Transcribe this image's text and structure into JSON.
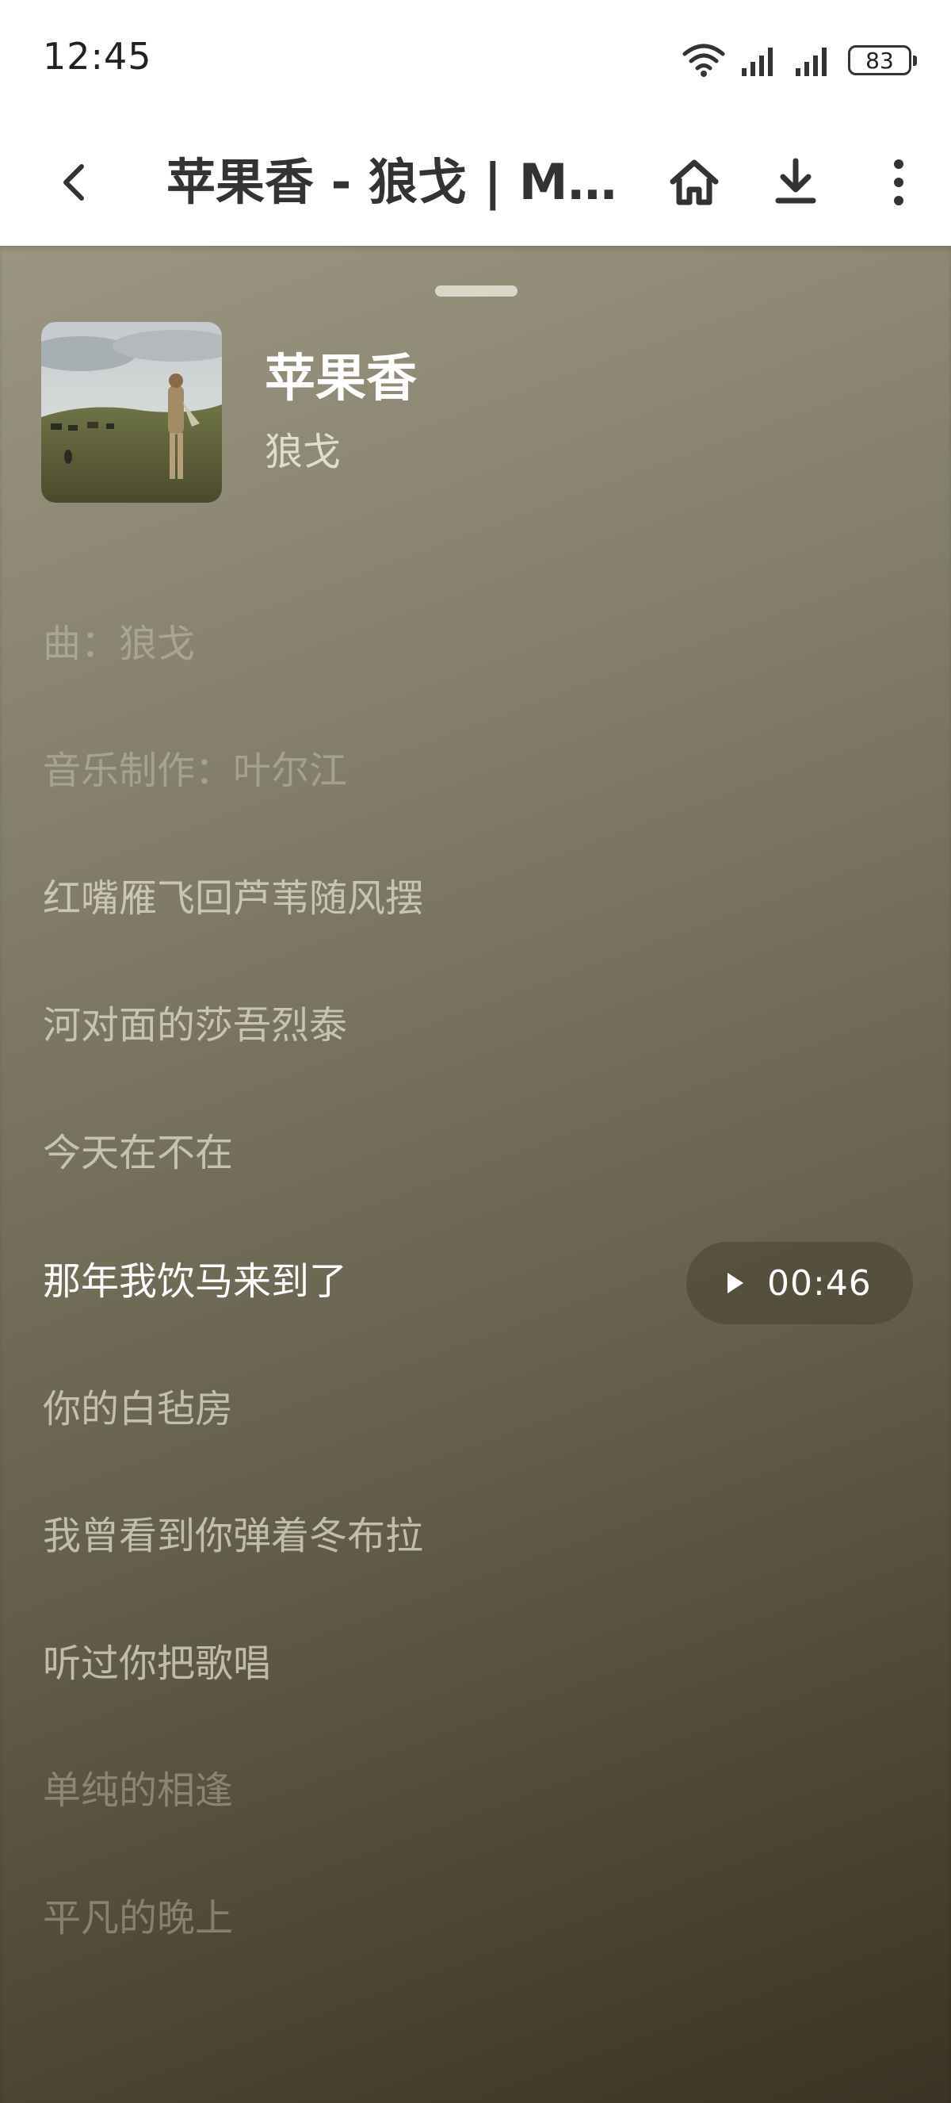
{
  "status_bar": {
    "time": "12:45",
    "battery": "83"
  },
  "header": {
    "title": "苹果香 - 狼戈 | My...",
    "icons": [
      "back-icon",
      "home-icon",
      "download-icon",
      "more-vert-icon"
    ]
  },
  "song": {
    "title": "苹果香",
    "artist": "狼戈"
  },
  "lyrics": [
    {
      "text": "曲：狼戈",
      "state": "faint"
    },
    {
      "text": "音乐制作：叶尔江",
      "state": "faint"
    },
    {
      "text": "红嘴雁飞回芦苇随风摆",
      "state": "normal"
    },
    {
      "text": "河对面的莎吾烈泰",
      "state": "normal"
    },
    {
      "text": "今天在不在",
      "state": "normal"
    },
    {
      "text": "那年我饮马来到了",
      "state": "active"
    },
    {
      "text": "你的白毡房",
      "state": "normal"
    },
    {
      "text": "我曾看到你弹着冬布拉",
      "state": "normal"
    },
    {
      "text": "听过你把歌唱",
      "state": "normal"
    },
    {
      "text": "单纯的相逢",
      "state": "faint"
    },
    {
      "text": "平凡的晚上",
      "state": "faint"
    }
  ],
  "seek": {
    "time": "00:46"
  },
  "colors": {
    "sheet_top": "#9a9681",
    "sheet_bottom": "#3a3424",
    "active_lyric": "#ffffff"
  }
}
